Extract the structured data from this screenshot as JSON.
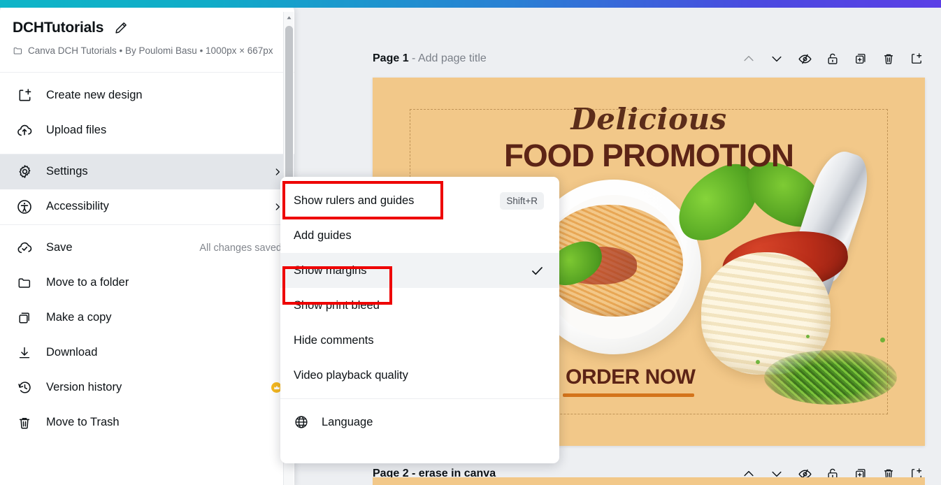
{
  "design": {
    "title": "DCHTutorials",
    "folder": "Canva DCH Tutorials",
    "meta": "Canva DCH Tutorials • By Poulomi Basu • 1000px × 667px",
    "author_line": "• By Poulomi Basu •",
    "dimensions": "1000px × 667px",
    "edit_icon": "pencil-icon"
  },
  "sidebar": {
    "groups": [
      {
        "items": [
          {
            "label": "Create new design",
            "icon": "create-new-design-icon"
          },
          {
            "label": "Upload files",
            "icon": "upload-cloud-icon"
          }
        ]
      },
      {
        "items": [
          {
            "label": "Settings",
            "icon": "gear-icon",
            "chevron": true,
            "highlighted": true
          },
          {
            "label": "Accessibility",
            "icon": "accessibility-icon",
            "chevron": true
          }
        ]
      },
      {
        "items": [
          {
            "label": "Save",
            "icon": "save-cloud-check-icon",
            "status": "All changes saved"
          },
          {
            "label": "Move to a folder",
            "icon": "folder-icon"
          },
          {
            "label": "Make a copy",
            "icon": "copy-icon"
          },
          {
            "label": "Download",
            "icon": "download-icon"
          },
          {
            "label": "Version history",
            "icon": "history-icon",
            "badge": "crown-icon"
          },
          {
            "label": "Move to Trash",
            "icon": "trash-icon"
          }
        ]
      }
    ],
    "scrollbar": {
      "arrow": "chevron-up-icon"
    }
  },
  "submenu": {
    "items": [
      {
        "label": "Show rulers and guides",
        "shortcut": "Shift+R",
        "annotated": true
      },
      {
        "label": "Add guides"
      },
      {
        "label": "Show margins",
        "checked": true,
        "highlighted": true,
        "annotated": true
      },
      {
        "label": "Show print bleed"
      },
      {
        "label": "Hide comments"
      },
      {
        "label": "Video playback quality"
      },
      {
        "label": "Language",
        "icon": "globe-icon",
        "divider_above": true
      }
    ],
    "check_icon": "checkmark-icon"
  },
  "pages": [
    {
      "label_bold": "Page 1",
      "label_muted": "- Add page title",
      "tools": [
        {
          "name": "move-page-up-icon",
          "disabled": true
        },
        {
          "name": "move-page-down-icon",
          "disabled": false
        },
        {
          "name": "hide-page-icon",
          "disabled": false
        },
        {
          "name": "lock-page-icon",
          "disabled": false
        },
        {
          "name": "duplicate-page-icon",
          "disabled": false
        },
        {
          "name": "delete-page-icon",
          "disabled": false
        },
        {
          "name": "add-page-icon",
          "disabled": false
        }
      ]
    },
    {
      "label_bold": "Page 2 - erase in canva",
      "label_muted": "",
      "tools": [
        {
          "name": "move-page-up-icon",
          "disabled": false
        },
        {
          "name": "move-page-down-icon",
          "disabled": false
        },
        {
          "name": "hide-page-icon",
          "disabled": false
        },
        {
          "name": "lock-page-icon",
          "disabled": false
        },
        {
          "name": "duplicate-page-icon",
          "disabled": false
        },
        {
          "name": "delete-page-icon",
          "disabled": false
        },
        {
          "name": "add-page-icon",
          "disabled": false
        }
      ]
    }
  ],
  "artwork": {
    "script_text": "Delicious",
    "headline": "FOOD PROMOTION",
    "cta": "ORDER NOW",
    "background_color": "#f2c889",
    "text_color": "#5c2416",
    "accent_color": "#d4741b"
  },
  "colors": {
    "gradient_start": "#0fb5c8",
    "gradient_end": "#5b3fe6",
    "annotation_red": "#ee0000",
    "highlight_gray": "#e3e6ea",
    "crown_gold": "#f5b820"
  }
}
